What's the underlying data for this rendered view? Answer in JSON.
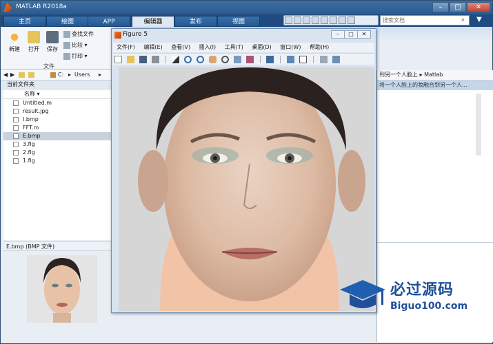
{
  "window": {
    "title": "MATLAB R2018a"
  },
  "tabs": [
    "主页",
    "绘图",
    "APP",
    "编辑器",
    "发布",
    "视图"
  ],
  "search": {
    "placeholder": "搜索文档"
  },
  "ribbon": {
    "new": "新建",
    "open": "打开",
    "save": "保存",
    "find_files": "查找文件",
    "compare": "比较",
    "print": "打印",
    "section": "文件"
  },
  "address": {
    "path": [
      "C:",
      "Users"
    ]
  },
  "current_folder": {
    "title": "当前文件夹",
    "column": "名称 ▾"
  },
  "files": [
    {
      "name": "Untitled.m",
      "selected": false
    },
    {
      "name": "result.jpg",
      "selected": false
    },
    {
      "name": "I.bmp",
      "selected": false
    },
    {
      "name": "FFT.m",
      "selected": false
    },
    {
      "name": "E.bmp",
      "selected": true
    },
    {
      "name": "3.fig",
      "selected": false
    },
    {
      "name": "2.fig",
      "selected": false
    },
    {
      "name": "1.fig",
      "selected": false
    }
  ],
  "details": {
    "title": "E.bmp  (BMP 文件)"
  },
  "right_panel": {
    "path": "到另一个人脸上 ▸ Matlab",
    "info": "将一个人脸上的妆融合到另一个人..."
  },
  "figure": {
    "title": "Figure 5",
    "menu": [
      "文件(F)",
      "编辑(E)",
      "查看(V)",
      "插入(I)",
      "工具(T)",
      "桌面(D)",
      "窗口(W)",
      "帮助(H)"
    ]
  },
  "watermark": {
    "cn": "必过源码",
    "url": "Biguo100.com"
  },
  "colors": {
    "titlebar": "#2b5a8e",
    "accent": "#1f4f9a"
  }
}
